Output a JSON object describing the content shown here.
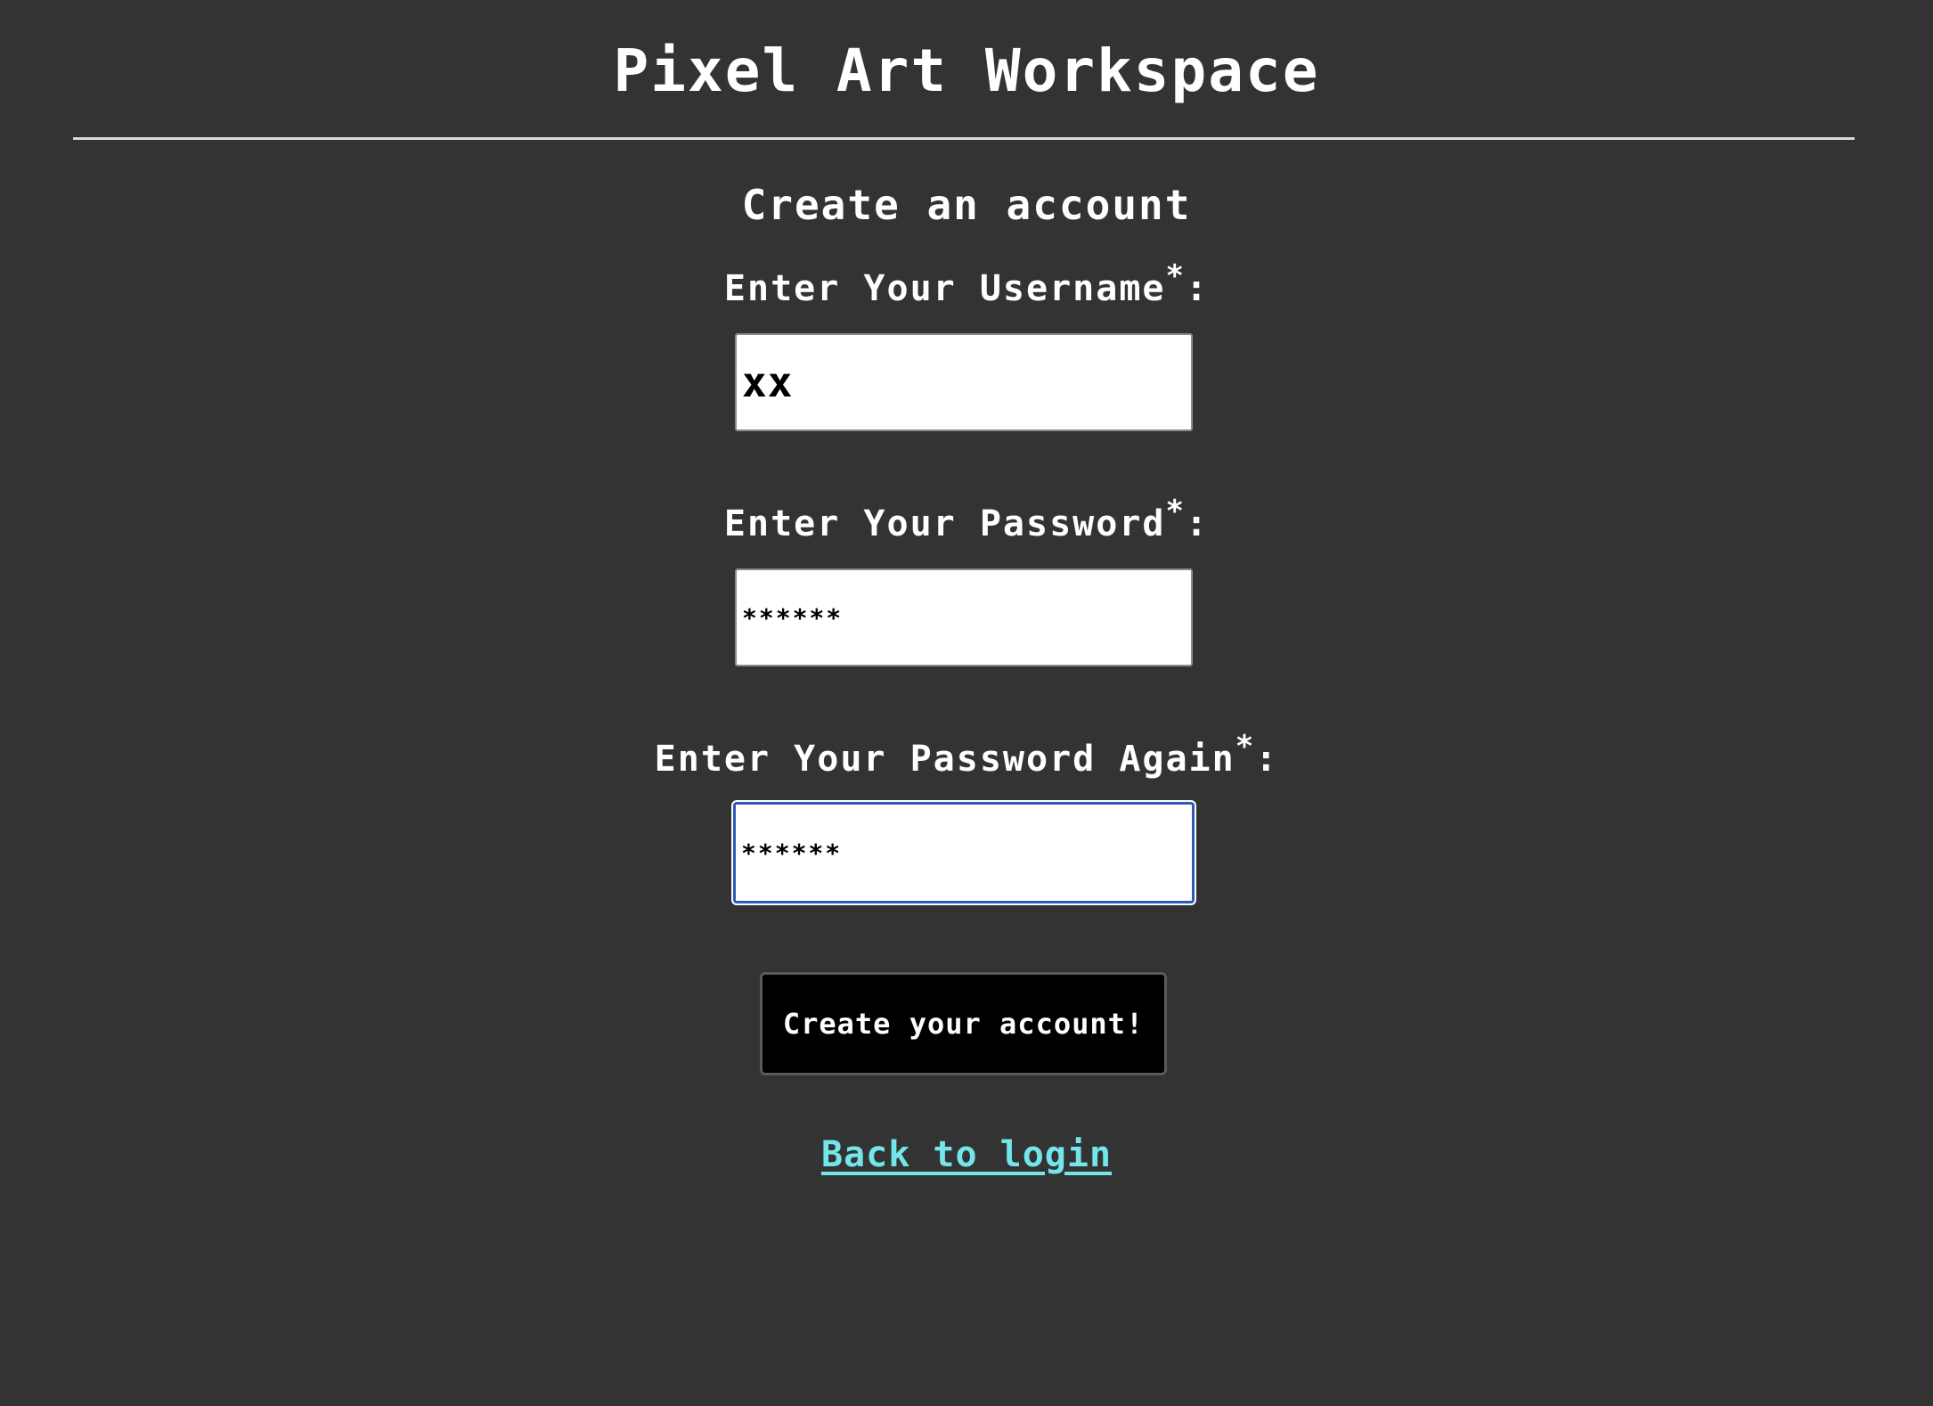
{
  "app": {
    "title": "Pixel Art Workspace"
  },
  "form": {
    "heading": "Create an account",
    "required_marker": "*",
    "colon": ":",
    "username": {
      "label": "Enter Your Username",
      "value": "xx"
    },
    "password": {
      "label": "Enter Your Password",
      "value": "******"
    },
    "password_again": {
      "label": "Enter Your Password Again",
      "value": "******"
    },
    "submit_label": "Create your account!",
    "back_link_label": "Back to login"
  },
  "colors": {
    "background": "#333333",
    "text": "#ffffff",
    "link": "#72e6ea",
    "button_bg": "#000000",
    "focus_ring": "#2c5bb8"
  }
}
